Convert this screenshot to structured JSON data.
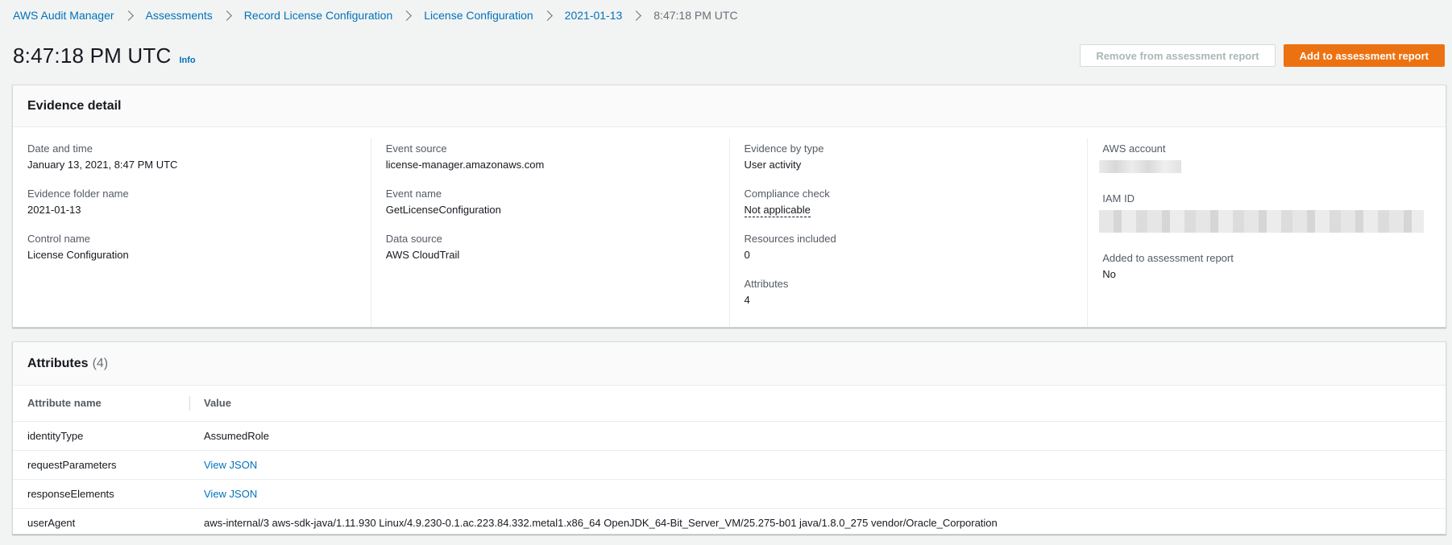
{
  "breadcrumb": [
    {
      "label": "AWS Audit Manager"
    },
    {
      "label": "Assessments"
    },
    {
      "label": "Record License Configuration"
    },
    {
      "label": "License Configuration"
    },
    {
      "label": "2021-01-13"
    },
    {
      "label": "8:47:18 PM UTC"
    }
  ],
  "header": {
    "title": "8:47:18 PM UTC",
    "info_label": "Info",
    "remove_button": "Remove from assessment report",
    "add_button": "Add to assessment report"
  },
  "evidence": {
    "title": "Evidence detail",
    "col1": [
      {
        "label": "Date and time",
        "value": "January 13, 2021, 8:47 PM UTC"
      },
      {
        "label": "Evidence folder name",
        "value": "2021-01-13"
      },
      {
        "label": "Control name",
        "value": "License Configuration"
      }
    ],
    "col2": [
      {
        "label": "Event source",
        "value": "license-manager.amazonaws.com"
      },
      {
        "label": "Event name",
        "value": "GetLicenseConfiguration"
      },
      {
        "label": "Data source",
        "value": "AWS CloudTrail"
      }
    ],
    "col3": [
      {
        "label": "Evidence by type",
        "value": "User activity"
      },
      {
        "label": "Compliance check",
        "value": "Not applicable"
      },
      {
        "label": "Resources included",
        "value": "0"
      },
      {
        "label": "Attributes",
        "value": "4"
      }
    ],
    "col4": {
      "account_label": "AWS account",
      "iam_label": "IAM ID",
      "added_label": "Added to assessment report",
      "added_value": "No"
    }
  },
  "attributes": {
    "title": "Attributes",
    "count": "(4)",
    "columns": {
      "name": "Attribute name",
      "value": "Value"
    },
    "rows": [
      {
        "name": "identityType",
        "value": "AssumedRole"
      },
      {
        "name": "requestParameters",
        "value": "View JSON"
      },
      {
        "name": "responseElements",
        "value": "View JSON"
      },
      {
        "name": "userAgent",
        "value": "aws-internal/3 aws-sdk-java/1.11.930 Linux/4.9.230-0.1.ac.223.84.332.metal1.x86_64 OpenJDK_64-Bit_Server_VM/25.275-b01 java/1.8.0_275 vendor/Oracle_Corporation"
      }
    ]
  },
  "colors": {
    "link": "#0073bb",
    "primary": "#ec7211",
    "background": "#f2f3f3"
  }
}
